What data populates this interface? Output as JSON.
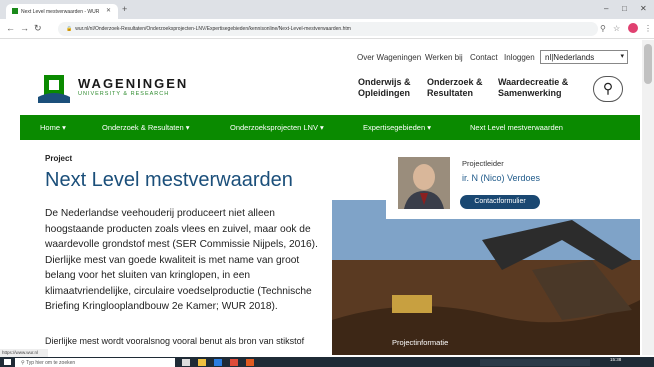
{
  "browser": {
    "tab_title": "Next Level mestverwaarden - WUR",
    "tab_close": "✕",
    "new_tab": "+",
    "url": "wur.nl/nl/Onderzoek-Resultaten/Onderzoeksprojecten-LNV/Expertisegebieden/kennisonline/Next-Level-mestverwaarden.htm",
    "status_url": "https://www.wur.nl"
  },
  "header": {
    "top_links": [
      "Over Wageningen",
      "Werken bij",
      "Contact",
      "Inloggen"
    ],
    "language": "nl|Nederlands",
    "logo_word": "WAGENINGEN",
    "logo_sub": "UNIVERSITY & RESEARCH",
    "menu": [
      {
        "line1": "Onderwijs &",
        "line2": "Opleidingen"
      },
      {
        "line1": "Onderzoek &",
        "line2": "Resultaten"
      },
      {
        "line1": "Waardecreatie &",
        "line2": "Samenwerking"
      }
    ],
    "search_icon": "search-icon"
  },
  "green_nav": [
    "Home",
    "Onderzoek & Resultaten",
    "Onderzoeksprojecten LNV",
    "Expertisegebieden",
    "Next Level mestverwaarden"
  ],
  "main": {
    "label": "Project",
    "title": "Next Level mestverwaarden",
    "paragraph": "De Nederlandse veehouderij produceert niet alleen hoogstaande producten zoals vlees en zuivel, maar ook de waardevolle grondstof mest (SER Commissie Nijpels, 2016). Dierlijke mest van goede kwaliteit is met name van groot belang voor het sluiten van kringlopen, in een klimaatvriendelijke, circulaire voedselproductie (Technische Briefing Kringlooplandbouw 2e Kamer; WUR 2018).",
    "paragraph2": "Dierlijke mest wordt vooralsnog vooral benut als bron van stikstof"
  },
  "sidebar": {
    "role": "Projectleider",
    "name": "ir. N (Nico) Verdoes",
    "contact_button": "Contactformulier",
    "image_caption": "Projectinformatie"
  },
  "taskbar": {
    "search_placeholder": "Typ hier om te zoeken",
    "time": "15:38"
  },
  "colors": {
    "green": "#0a8a00",
    "title_blue": "#1b4f7a",
    "button_navy": "#1a4872"
  }
}
